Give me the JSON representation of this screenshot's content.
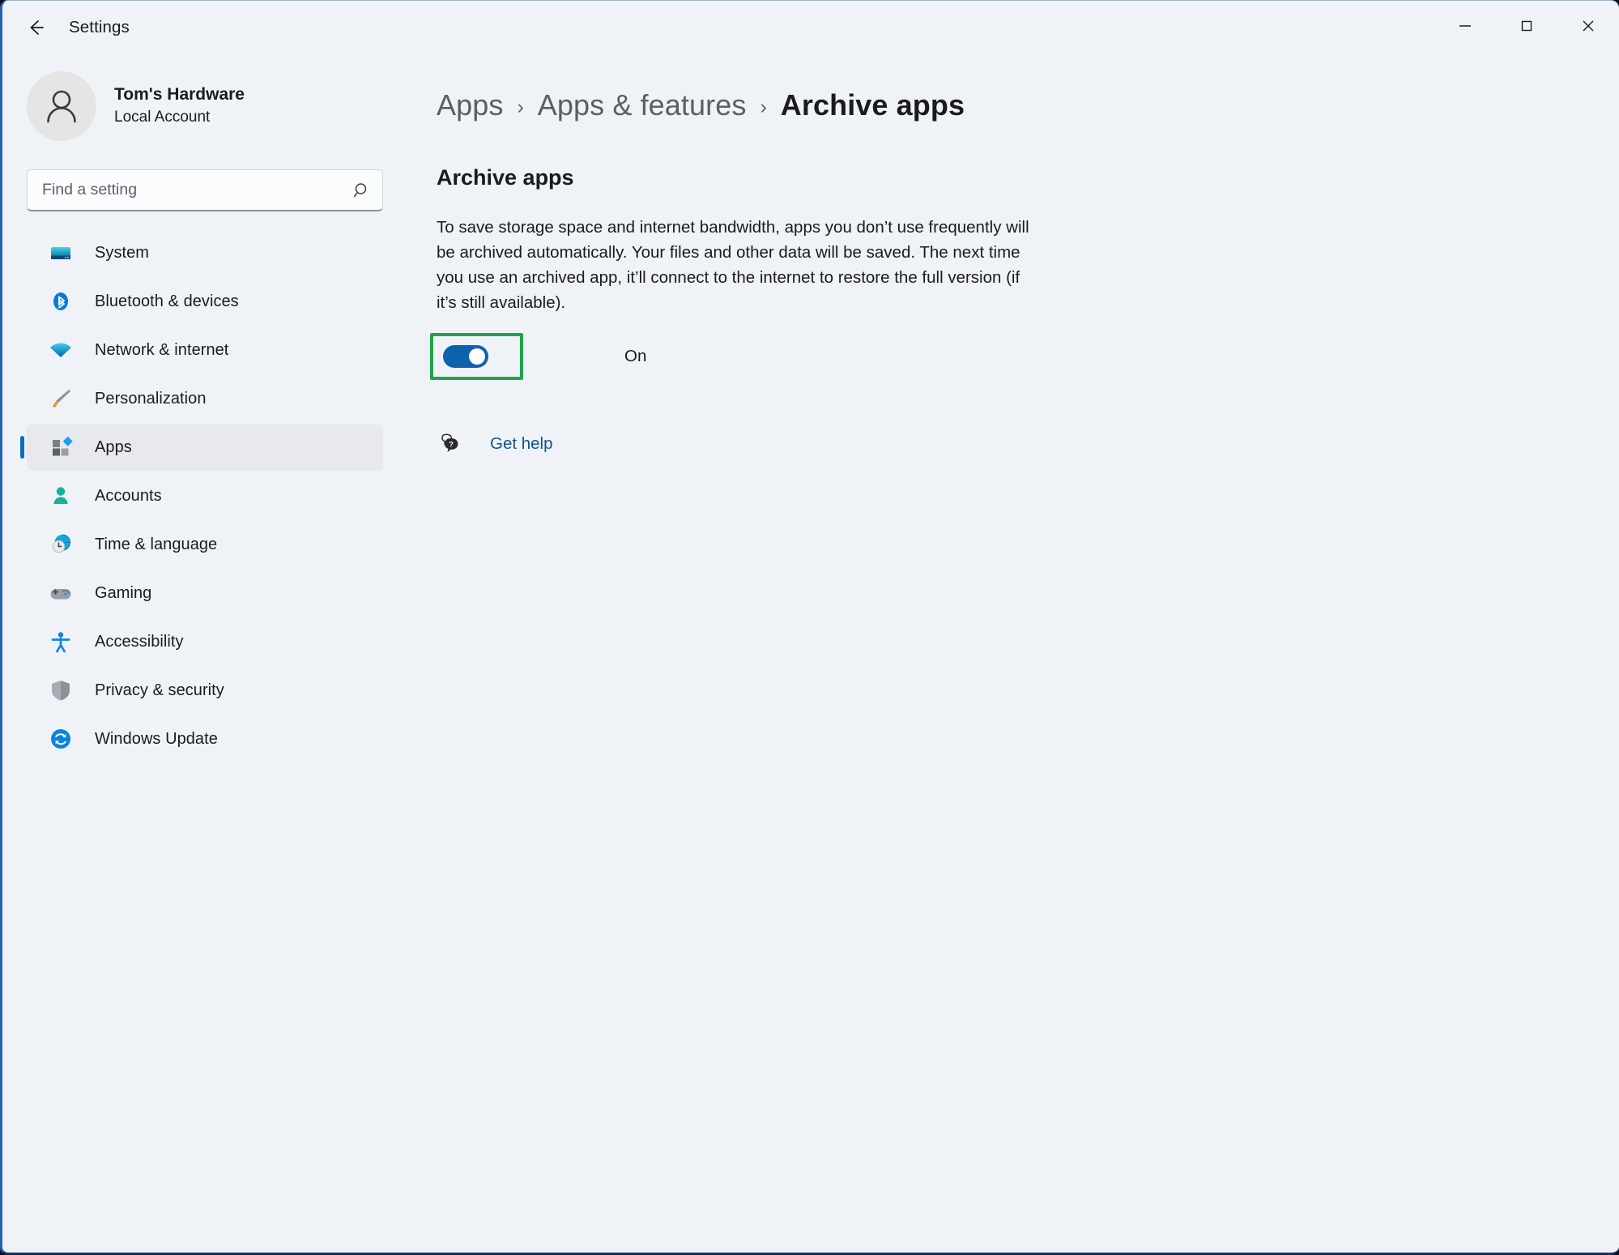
{
  "window": {
    "title": "Settings",
    "back_icon": "back-arrow-icon",
    "controls": {
      "minimize": "minimize-icon",
      "maximize": "maximize-icon",
      "close": "close-icon"
    }
  },
  "sidebar": {
    "account": {
      "name": "Tom's Hardware",
      "type": "Local Account",
      "avatar_icon": "person-avatar-icon"
    },
    "search": {
      "placeholder": "Find a setting",
      "value": "",
      "icon": "search-icon"
    },
    "items": [
      {
        "label": "System",
        "icon": "monitor-icon",
        "selected": false
      },
      {
        "label": "Bluetooth & devices",
        "icon": "bluetooth-icon",
        "selected": false
      },
      {
        "label": "Network & internet",
        "icon": "wifi-icon",
        "selected": false
      },
      {
        "label": "Personalization",
        "icon": "paintbrush-icon",
        "selected": false
      },
      {
        "label": "Apps",
        "icon": "apps-grid-icon",
        "selected": true
      },
      {
        "label": "Accounts",
        "icon": "person-icon",
        "selected": false
      },
      {
        "label": "Time & language",
        "icon": "globe-clock-icon",
        "selected": false
      },
      {
        "label": "Gaming",
        "icon": "gamepad-icon",
        "selected": false
      },
      {
        "label": "Accessibility",
        "icon": "accessibility-person-icon",
        "selected": false
      },
      {
        "label": "Privacy & security",
        "icon": "shield-icon",
        "selected": false
      },
      {
        "label": "Windows Update",
        "icon": "refresh-circle-icon",
        "selected": false
      }
    ]
  },
  "main": {
    "breadcrumb": [
      {
        "label": "Apps",
        "current": false
      },
      {
        "label": "Apps & features",
        "current": false
      },
      {
        "label": "Archive apps",
        "current": true
      }
    ],
    "breadcrumb_separator": "›",
    "section_title": "Archive apps",
    "description": "To save storage space and internet bandwidth, apps you don’t use frequently will be archived automatically. Your files and other data will be saved. The next time you use an archived app, it’ll connect to the internet to restore the full version (if it’s still available).",
    "toggle": {
      "state_label": "On",
      "enabled": true,
      "highlighted": true
    },
    "help": {
      "label": "Get help",
      "icon": "help-question-bubble-icon"
    }
  },
  "colors": {
    "window_background": "#eff3f8",
    "accent_blue": "#0f6cbd",
    "toggle_on": "#0d62ad",
    "link_blue": "#0f548c",
    "annotation_green": "#22a24a",
    "selected_row": "#e7e9ed",
    "text_primary": "#1b1b1b",
    "text_secondary": "#5a5f66"
  }
}
